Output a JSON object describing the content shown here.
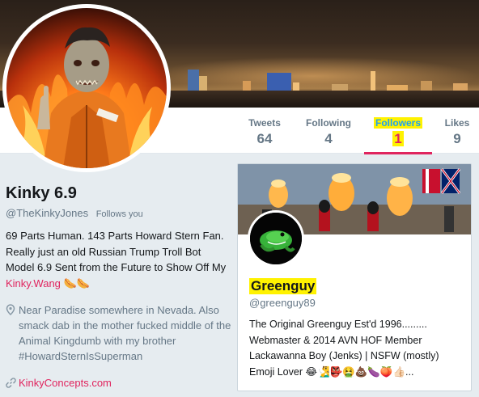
{
  "stats": [
    {
      "label": "Tweets",
      "value": "64"
    },
    {
      "label": "Following",
      "value": "4"
    },
    {
      "label": "Followers",
      "value": "1"
    },
    {
      "label": "Likes",
      "value": "9"
    }
  ],
  "profile": {
    "name": "Kinky 6.9",
    "handle": "@TheKinkyJones",
    "follows_you": "Follows you",
    "bio_text": "69 Parts Human. 143 Parts Howard Stern Fan. Really just an old Russian Trump Troll Bot Model 6.9 Sent from the Future to Show Off My ",
    "bio_link": "Kinky.Wang",
    "bio_emoji": "🌭🌭",
    "location": "Near Paradise somewhere in Nevada. Also smack dab in the mother fucked middle of the Animal Kingdumb with my brother #HowardSternIsSuperman",
    "website": "KinkyConcepts.com"
  },
  "card": {
    "name": "Greenguy",
    "handle": "@greenguy89",
    "bio": "The Original Greenguy Est'd 1996......... Webmaster & 2014 AVN HOF Member Lackawanna Boy (Jenks) | NSFW (mostly) Emoji Lover 😂🧏‍♂️👺🤮💩🍆🍑👍🏻..."
  },
  "colors": {
    "accent": "#e0245e",
    "link_blue": "#1da1f2",
    "highlight": "#fff200",
    "muted": "#657786",
    "background": "#e6ecf0"
  },
  "icons": [
    "location-pin-icon",
    "link-icon"
  ]
}
